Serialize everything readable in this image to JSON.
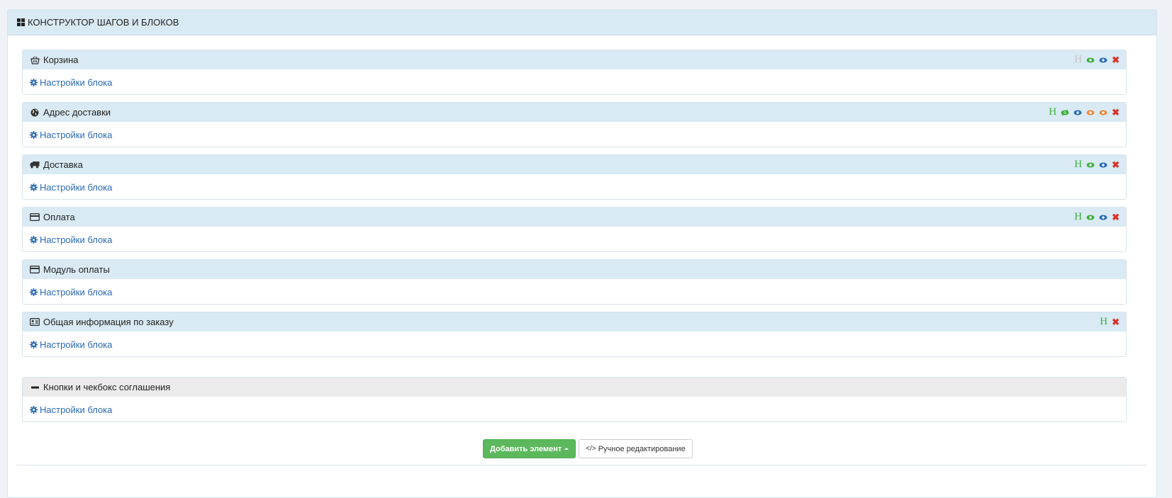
{
  "panel": {
    "title": "КОНСТРУКТОР ШАГОВ И БЛОКОВ"
  },
  "settings_label": "Настройки блока",
  "blocks": [
    {
      "title": "Корзина",
      "icon": "basket-icon"
    },
    {
      "title": "Адрес доставки",
      "icon": "globe-icon"
    },
    {
      "title": "Доставка",
      "icon": "truck-icon"
    },
    {
      "title": "Оплата",
      "icon": "credit-card-icon"
    },
    {
      "title": "Модуль оплаты",
      "icon": "credit-card-icon"
    },
    {
      "title": "Общая информация по заказу",
      "icon": "id-card-icon"
    },
    {
      "title": "Кнопки и чекбокс соглашения",
      "icon": "minus-icon"
    }
  ],
  "actions": {
    "h_letter": "H"
  },
  "colors": {
    "green": "#3cae3c",
    "gray": "#c5c5c5",
    "blue": "#2a6ab3",
    "orange": "#f0883a",
    "red": "#d9342b"
  },
  "buttons": {
    "add_element": "Добавить элемент",
    "manual_edit": "Ручное редактирование"
  }
}
